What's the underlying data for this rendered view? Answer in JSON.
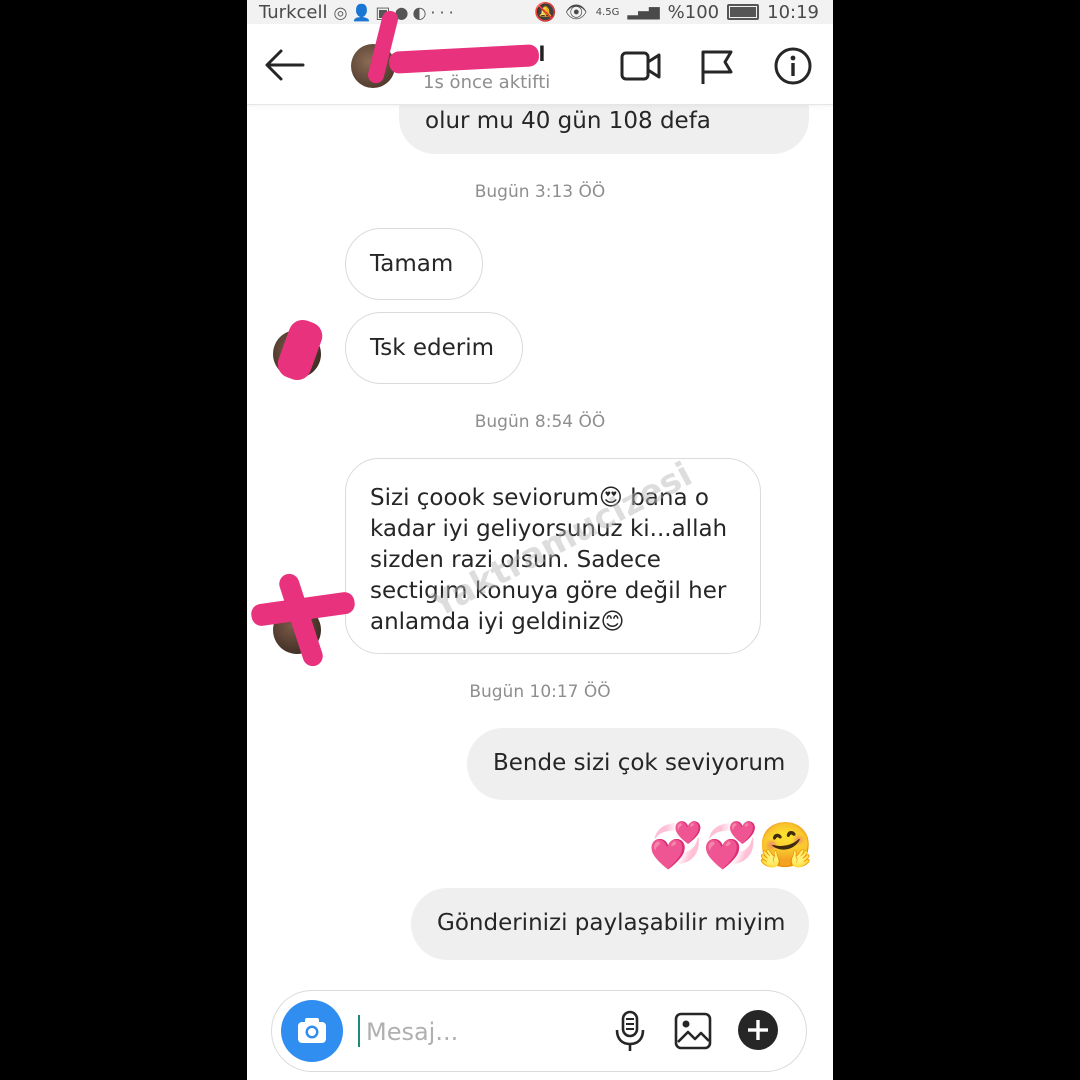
{
  "status_bar": {
    "carrier": "Turkcell",
    "icons": [
      "instagram-icon",
      "add-user-icon",
      "facebook-icon",
      "message-icon",
      "app-icon"
    ],
    "more": "···",
    "network": "4.5G",
    "battery": "%100",
    "time": "10:19"
  },
  "header": {
    "name_fragment": "al",
    "subtitle": "1s önce aktifti"
  },
  "messages": {
    "m0": "olur mu 40 gün 108 defa",
    "t1": "Bugün 3:13 ÖÖ",
    "m1": "Tamam",
    "m2": "Tsk ederim",
    "t2": "Bugün 8:54 ÖÖ",
    "m3": "Sizi çoook seviorum😍 bana o kadar iyi geliyorsunuz ki...allah sizden razi olsun. Sadece sectigim konuya göre değil her anlamda iyi geldiniz😊",
    "t3": "Bugün 10:17 ÖÖ",
    "m4": "Bende sizi çok seviyorum",
    "m5": "💞💞🤗",
    "m6": "Gönderinizi paylaşabilir miyim"
  },
  "composer": {
    "placeholder": "Mesaj..."
  },
  "watermark": "Yaktramucizesi",
  "colors": {
    "accent_blue": "#2f8ef0",
    "scribble_pink": "#e8327d",
    "outgoing_bubble": "#efefef"
  }
}
